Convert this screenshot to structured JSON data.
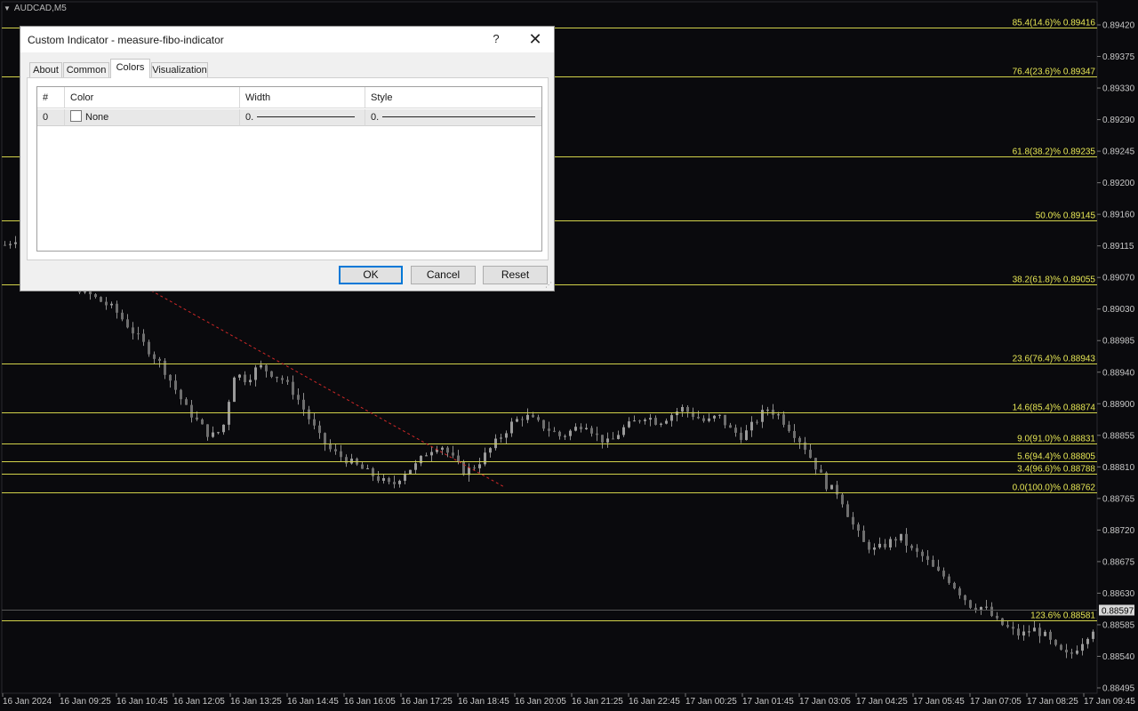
{
  "window": {
    "title": "AUDCAD,M5"
  },
  "chart_data": {
    "type": "candlestick",
    "symbol": "AUDCAD,M5",
    "ylim": [
      0.88485,
      0.8944
    ],
    "y_ticks": [
      "0.89420",
      "0.89375",
      "0.89330",
      "0.89290",
      "0.89245",
      "0.89200",
      "0.89160",
      "0.89115",
      "0.89070",
      "0.89030",
      "0.88985",
      "0.88940",
      "0.88900",
      "0.88855",
      "0.88810",
      "0.88765",
      "0.88720",
      "0.88675",
      "0.88630",
      "0.88585",
      "0.88540",
      "0.88495"
    ],
    "x_ticks": [
      "16 Jan 2024",
      "16 Jan 09:25",
      "16 Jan 10:45",
      "16 Jan 12:05",
      "16 Jan 13:25",
      "16 Jan 14:45",
      "16 Jan 16:05",
      "16 Jan 17:25",
      "16 Jan 18:45",
      "16 Jan 20:05",
      "16 Jan 21:25",
      "16 Jan 22:45",
      "17 Jan 00:25",
      "17 Jan 01:45",
      "17 Jan 03:05",
      "17 Jan 04:25",
      "17 Jan 05:45",
      "17 Jan 07:05",
      "17 Jan 08:25",
      "17 Jan 09:45"
    ],
    "current_price": "0.88597",
    "fibo_levels": [
      {
        "label": "85.4(14.6)% 0.89416",
        "price": 0.89416
      },
      {
        "label": "76.4(23.6)% 0.89347",
        "price": 0.89347
      },
      {
        "label": "61.8(38.2)% 0.89235",
        "price": 0.89235
      },
      {
        "label": "50.0% 0.89145",
        "price": 0.89145
      },
      {
        "label": "38.2(61.8)% 0.89055",
        "price": 0.89055
      },
      {
        "label": "23.6(76.4)% 0.88943",
        "price": 0.88943
      },
      {
        "label": "14.6(85.4)% 0.88874",
        "price": 0.88874
      },
      {
        "label": "9.0(91.0)% 0.88831",
        "price": 0.88831
      },
      {
        "label": "5.6(94.4)% 0.88805",
        "price": 0.88805
      },
      {
        "label": "3.4(96.6)% 0.88788",
        "price": 0.88788
      },
      {
        "label": "0.0(100.0)% 0.88762",
        "price": 0.88762
      },
      {
        "label": "123.6% 0.88581",
        "price": 0.88581
      }
    ],
    "close_path": [
      0.8911,
      0.8912,
      0.891,
      0.8908,
      0.8907,
      0.8906,
      0.8905,
      0.8904,
      0.8903,
      0.8902,
      0.89,
      0.8898,
      0.8896,
      0.8894,
      0.8891,
      0.8888,
      0.8886,
      0.8884,
      0.8885,
      0.8893,
      0.8892,
      0.8894,
      0.8893,
      0.8892,
      0.889,
      0.8887,
      0.8884,
      0.8882,
      0.8881,
      0.888,
      0.8879,
      0.8878,
      0.8877,
      0.8879,
      0.888,
      0.8882,
      0.8883,
      0.8881,
      0.8879,
      0.888,
      0.8882,
      0.8884,
      0.8886,
      0.8887,
      0.8886,
      0.8885,
      0.8884,
      0.8885,
      0.8886,
      0.8884,
      0.8883,
      0.8885,
      0.8886,
      0.8887,
      0.8886,
      0.8887,
      0.8888,
      0.8887,
      0.8886,
      0.8887,
      0.8885,
      0.8884,
      0.8886,
      0.8888,
      0.8887,
      0.8885,
      0.8883,
      0.888,
      0.8877,
      0.8876,
      0.8872,
      0.8869,
      0.8868,
      0.8869,
      0.887,
      0.8868,
      0.8867,
      0.8865,
      0.8864,
      0.8862,
      0.886,
      0.886,
      0.8858,
      0.8857,
      0.8856,
      0.8857,
      0.8856,
      0.8854,
      0.8853,
      0.8855,
      0.8857
    ],
    "colors": {
      "fibo": "#d2d24a",
      "label": "#e8e855",
      "candle": "#8c8c8c",
      "trend": "#d02828",
      "axis_text": "#c8c8c8"
    }
  },
  "dialog": {
    "title": "Custom Indicator - measure-fibo-indicator",
    "help": "?",
    "close": "✕",
    "tabs": [
      {
        "label": "About"
      },
      {
        "label": "Common"
      },
      {
        "label": "Colors"
      },
      {
        "label": "Visualization"
      }
    ],
    "active_tab": "Colors",
    "table": {
      "headers": [
        "#",
        "Color",
        "Width",
        "Style"
      ],
      "rows": [
        {
          "index": "0",
          "color": "None",
          "width": "0.",
          "style": "0."
        }
      ]
    },
    "buttons": {
      "ok": "OK",
      "cancel": "Cancel",
      "reset": "Reset"
    }
  }
}
